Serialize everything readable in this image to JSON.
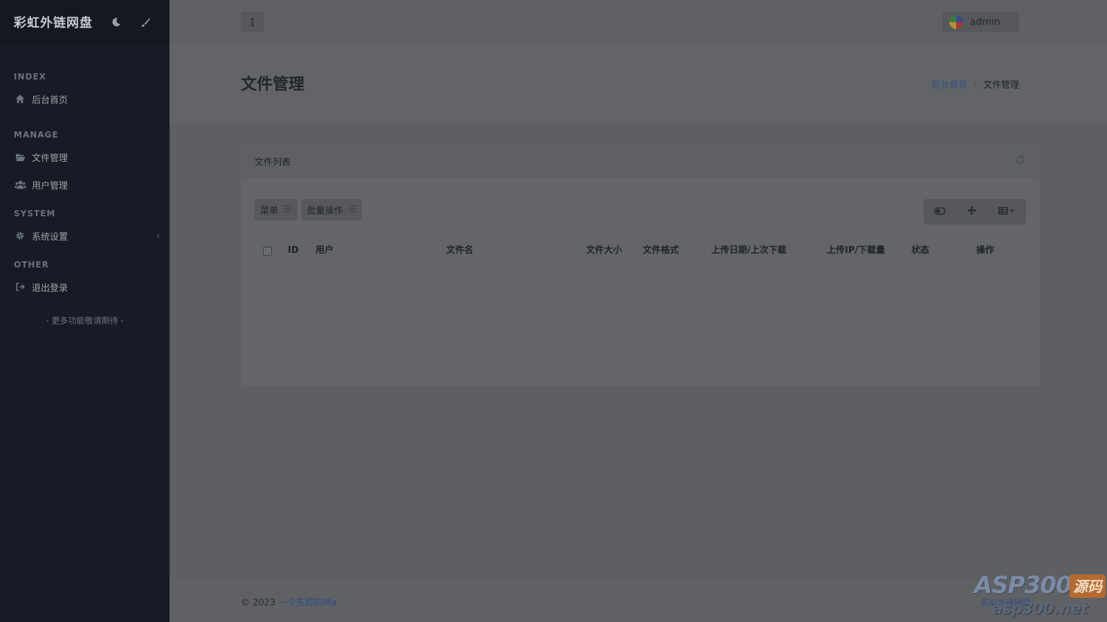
{
  "sidebar": {
    "brand": "彩虹外链网盘",
    "icons": [
      "moon-icon",
      "brush-icon"
    ],
    "sections": {
      "index": "INDEX",
      "manage": "MANAGE",
      "system": "SYSTEM",
      "other": "OTHER"
    },
    "items": {
      "home": "后台首页",
      "files": "文件管理",
      "users": "用户管理",
      "settings": "系统设置",
      "logout": "退出登录"
    },
    "more": "- 更多功能敬请期待 -"
  },
  "topbar": {
    "menu_icon": "more-vertical-icon",
    "user": "admin"
  },
  "page": {
    "title": "文件管理",
    "breadcrumb": {
      "home": "后台首页",
      "current": "文件管理"
    }
  },
  "card": {
    "title": "文件列表",
    "toolbar": {
      "menu": "菜单",
      "batch": "批量操作"
    },
    "tool_icons": [
      "toggle-icon",
      "move-icon",
      "columns-icon"
    ],
    "columns": [
      "ID",
      "用户",
      "文件名",
      "文件大小",
      "文件格式",
      "上传日期/上次下载",
      "上传IP/下载量",
      "状态",
      "操作"
    ]
  },
  "footer": {
    "copyright": "© 2023 ",
    "author": "一个失踪的Ma.",
    "right_link": "彩虹外链网盘"
  },
  "watermark": {
    "top": "ASP300",
    "badge": "源码",
    "bottom": "asp300.net"
  },
  "colors": {
    "overlay_bg": "#5d5f63",
    "sidebar_bg": "#161b25",
    "link": "#2f4f86",
    "watermark_badge": "#b46a30"
  }
}
